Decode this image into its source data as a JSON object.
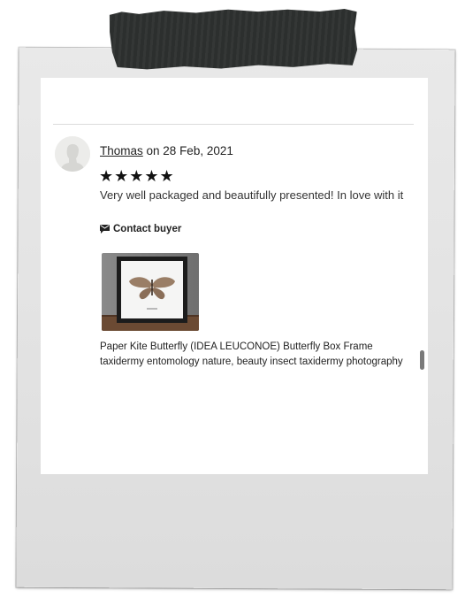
{
  "review": {
    "reviewer_name": "Thomas",
    "date_text": " on 28 Feb, 2021",
    "stars": "★★★★★",
    "rating": 5,
    "text": "Very well packaged and beautifully presented! In love with it"
  },
  "actions": {
    "contact_buyer_label": "Contact buyer"
  },
  "product": {
    "title": "Paper Kite Butterfly (IDEA LEUCONOE) Butterfly Box Frame taxidermy entomology nature, beauty insect taxidermy photography"
  },
  "icons": {
    "avatar": "user-avatar-silhouette",
    "contact": "message-icon"
  },
  "colors": {
    "tape": "#2e3130",
    "frame": "#e6e6e6",
    "text": "#222222"
  }
}
